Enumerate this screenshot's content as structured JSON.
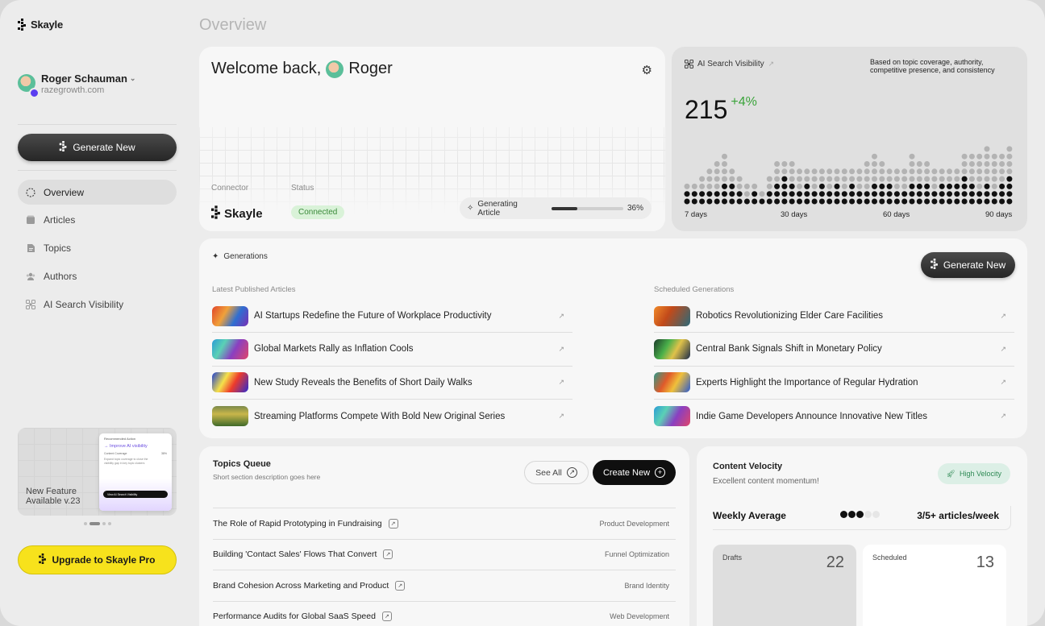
{
  "brand": {
    "name": "Skayle"
  },
  "page": {
    "title": "Overview"
  },
  "user": {
    "name": "Roger Schauman",
    "domain": "razegrowth.com"
  },
  "sidebar": {
    "generate_label": "Generate New",
    "items": [
      {
        "label": "Overview",
        "icon": "overview-icon"
      },
      {
        "label": "Articles",
        "icon": "articles-icon"
      },
      {
        "label": "Topics",
        "icon": "topics-icon"
      },
      {
        "label": "Authors",
        "icon": "authors-icon"
      },
      {
        "label": "AI Search Visibility",
        "icon": "ai-visibility-icon"
      }
    ],
    "feature": {
      "line1": "New Feature",
      "line2": "Available v.23",
      "card_title": "Recommended Action",
      "card_heading": "→ Improve AI visibility",
      "card_row_label": "Content Coverage",
      "card_row_value": "38%",
      "card_lines": [
        "Expand topic coverage to close the",
        "visibility gap in key topic clusters"
      ],
      "card_button": "View AI Search Visibility"
    },
    "upgrade_label": "Upgrade to Skayle Pro"
  },
  "welcome": {
    "greeting": "Welcome back,",
    "name": "Roger",
    "connector_label": "Connector",
    "connector_name": "Skayle",
    "status_label": "Status",
    "status_value": "Connected",
    "generating_label": "Generating Article",
    "progress": 36,
    "progress_text": "36%"
  },
  "visibility": {
    "title": "AI Search Visibility",
    "note": "Based on topic coverage, authority, competitive presence, and consistency",
    "score": "215",
    "delta": "+4%",
    "axis": [
      "7 days",
      "30 days",
      "60 days",
      "90 days"
    ],
    "column_counts": [
      [
        2,
        1
      ],
      [
        2,
        1
      ],
      [
        2,
        2
      ],
      [
        2,
        3
      ],
      [
        2,
        4
      ],
      [
        3,
        4
      ],
      [
        3,
        2
      ],
      [
        2,
        2
      ],
      [
        1,
        2
      ],
      [
        2,
        1
      ],
      [
        1,
        1
      ],
      [
        2,
        2
      ],
      [
        3,
        3
      ],
      [
        4,
        2
      ],
      [
        3,
        3
      ],
      [
        2,
        3
      ],
      [
        3,
        2
      ],
      [
        2,
        3
      ],
      [
        3,
        2
      ],
      [
        2,
        3
      ],
      [
        3,
        2
      ],
      [
        2,
        3
      ],
      [
        3,
        2
      ],
      [
        2,
        3
      ],
      [
        2,
        4
      ],
      [
        3,
        4
      ],
      [
        3,
        3
      ],
      [
        3,
        2
      ],
      [
        2,
        3
      ],
      [
        2,
        3
      ],
      [
        3,
        4
      ],
      [
        3,
        3
      ],
      [
        3,
        3
      ],
      [
        2,
        3
      ],
      [
        3,
        2
      ],
      [
        3,
        2
      ],
      [
        3,
        2
      ],
      [
        4,
        3
      ],
      [
        3,
        4
      ],
      [
        2,
        5
      ],
      [
        3,
        5
      ],
      [
        2,
        5
      ],
      [
        3,
        4
      ],
      [
        4,
        4
      ]
    ],
    "colors": {
      "filled": "#111111",
      "empty": "#b3b3b3"
    }
  },
  "generations": {
    "title": "Generations",
    "button": "Generate New",
    "published_label": "Latest Published Articles",
    "scheduled_label": "Scheduled Generations",
    "published": [
      "AI Startups Redefine the Future of Workplace Productivity",
      "Global Markets Rally as Inflation Cools",
      "New Study Reveals the Benefits of Short Daily Walks",
      "Streaming Platforms Compete With Bold New Original Series"
    ],
    "scheduled": [
      "Robotics Revolutionizing Elder Care Facilities",
      "Central Bank Signals Shift in Monetary Policy",
      "Experts Highlight the Importance of Regular Hydration",
      "Indie Game Developers Announce Innovative New Titles"
    ]
  },
  "topics": {
    "title": "Topics Queue",
    "description": "Short section description goes here",
    "see_all": "See All",
    "create": "Create New",
    "items": [
      {
        "title": "The Role of Rapid Prototyping in Fundraising",
        "category": "Product Development"
      },
      {
        "title": "Building 'Contact Sales' Flows That Convert",
        "category": "Funnel Optimization"
      },
      {
        "title": "Brand Cohesion Across Marketing and Product",
        "category": "Brand Identity"
      },
      {
        "title": "Performance Audits for Global SaaS Speed",
        "category": "Web Development"
      }
    ]
  },
  "velocity": {
    "title": "Content Velocity",
    "subtitle": "Excellent content momentum!",
    "badge": "High Velocity",
    "weekly_label": "Weekly Average",
    "weekly_value": "3/5+ articles/week",
    "weekly_score": 3,
    "weekly_max": 5,
    "drafts_label": "Drafts",
    "drafts": "22",
    "scheduled_label": "Scheduled",
    "scheduled": "13"
  }
}
